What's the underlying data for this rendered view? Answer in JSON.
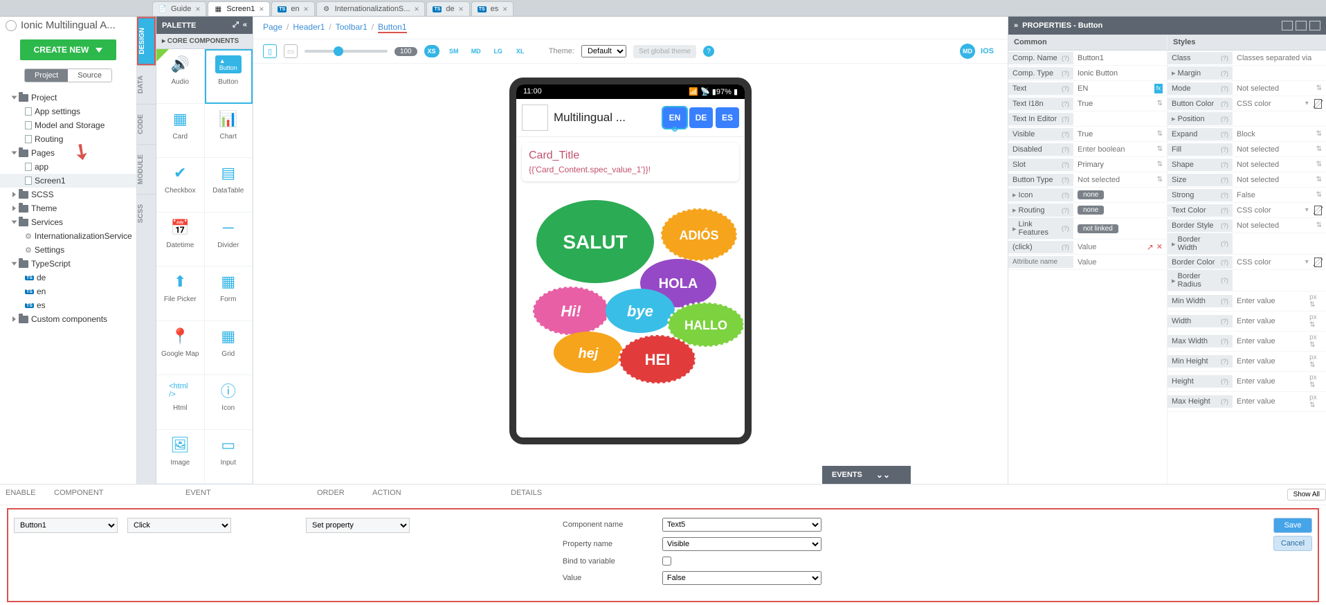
{
  "projectTitle": "Ionic Multilingual A...",
  "tabs": [
    {
      "label": "Guide",
      "icon": "doc"
    },
    {
      "label": "Screen1",
      "icon": "page",
      "active": true
    },
    {
      "label": "en",
      "icon": "ts"
    },
    {
      "label": "InternationalizationS...",
      "icon": "gear"
    },
    {
      "label": "de",
      "icon": "ts"
    },
    {
      "label": "es",
      "icon": "ts"
    }
  ],
  "createNew": "CREATE NEW",
  "toggle": {
    "on": "Project",
    "off": "Source"
  },
  "tree": [
    {
      "label": "Project",
      "lvl": 1,
      "open": true,
      "icon": "folder"
    },
    {
      "label": "App settings",
      "lvl": 2,
      "icon": "page"
    },
    {
      "label": "Model and Storage",
      "lvl": 2,
      "icon": "page"
    },
    {
      "label": "Routing",
      "lvl": 2,
      "icon": "page"
    },
    {
      "label": "Pages",
      "lvl": 1,
      "open": true,
      "icon": "folder"
    },
    {
      "label": "app",
      "lvl": 2,
      "icon": "page"
    },
    {
      "label": "Screen1",
      "lvl": 2,
      "icon": "page",
      "sel": true,
      "arrow": true
    },
    {
      "label": "SCSS",
      "lvl": 1,
      "icon": "folder"
    },
    {
      "label": "Theme",
      "lvl": 1,
      "icon": "folder"
    },
    {
      "label": "Services",
      "lvl": 1,
      "open": true,
      "icon": "folder"
    },
    {
      "label": "InternationalizationService",
      "lvl": 2,
      "icon": "gear"
    },
    {
      "label": "Settings",
      "lvl": 2,
      "icon": "gear"
    },
    {
      "label": "TypeScript",
      "lvl": 1,
      "open": true,
      "icon": "folder"
    },
    {
      "label": "de",
      "lvl": 2,
      "icon": "ts"
    },
    {
      "label": "en",
      "lvl": 2,
      "icon": "ts"
    },
    {
      "label": "es",
      "lvl": 2,
      "icon": "ts"
    },
    {
      "label": "Custom components",
      "lvl": 1,
      "icon": "folder"
    }
  ],
  "sideTabs": [
    "DESIGN",
    "DATA",
    "CODE",
    "MODULE",
    "SCSS"
  ],
  "palette": {
    "title": "PALETTE",
    "sub": "▸ CORE COMPONENTS",
    "items": [
      "Audio",
      "Button",
      "Card",
      "Chart",
      "Checkbox",
      "DataTable",
      "Datetime",
      "Divider",
      "File Picker",
      "Form",
      "Google Map",
      "Grid",
      "Html",
      "Icon",
      "Image",
      "Input"
    ]
  },
  "breadcrumb": [
    "Page",
    "Header1",
    "Toolbar1",
    "Button1"
  ],
  "toolbar": {
    "zoom": "100",
    "breakpoints": [
      "XS",
      "SM",
      "MD",
      "LG",
      "XL"
    ],
    "themeLabel": "Theme:",
    "themeValue": "Default",
    "globalTheme": "Set global theme",
    "md": "MD",
    "ios": "IOS"
  },
  "phone": {
    "time": "11:00",
    "battery": "97%",
    "title": "Multilingual ...",
    "langs": [
      "EN",
      "DE",
      "ES"
    ],
    "cardTitle": "Card_Title",
    "cardSub": "{{'Card_Content.spec_value_1'}}!"
  },
  "eventsLabel": "EVENTS",
  "props": {
    "title": "PROPERTIES - Button",
    "commonHdr": "Common",
    "stylesHdr": "Styles",
    "common": [
      {
        "k": "Comp. Name",
        "v": "Button1"
      },
      {
        "k": "Comp. Type",
        "v": "Ionic Button"
      },
      {
        "k": "Text",
        "v": "EN",
        "fx": true
      },
      {
        "k": "Text I18n",
        "v": "True",
        "dd": true
      },
      {
        "k": "Text In Editor",
        "v": ""
      },
      {
        "k": "Visible",
        "v": "True",
        "dd": true
      },
      {
        "k": "Disabled",
        "v": "",
        "ph": "Enter boolean",
        "dd": true
      },
      {
        "k": "Slot",
        "v": "Primary",
        "dd": true
      },
      {
        "k": "Button Type",
        "v": "",
        "ph": "Not selected",
        "dd": true
      },
      {
        "k": "Icon",
        "v": "none",
        "chip": true,
        "sub": true
      },
      {
        "k": "Routing",
        "v": "none",
        "chip": true,
        "sub": true
      },
      {
        "k": "Link Features",
        "v": "not linked",
        "chip": true,
        "sub": true
      },
      {
        "k": "(click)",
        "v": "",
        "ph": "Value",
        "red": true
      },
      {
        "k": "",
        "ph2": "Attribute name",
        "v": "",
        "ph": "Value"
      }
    ],
    "styles": [
      {
        "k": "Class",
        "v": "",
        "ph": "Classes separated via"
      },
      {
        "k": "Margin",
        "sub": true
      },
      {
        "k": "Mode",
        "v": "",
        "ph": "Not selected",
        "dd": true
      },
      {
        "k": "Button Color",
        "v": "",
        "ph": "CSS color",
        "np": true
      },
      {
        "k": "Position",
        "sub": true
      },
      {
        "k": "Expand",
        "v": "",
        "ph": "Block",
        "dd": true
      },
      {
        "k": "Fill",
        "v": "",
        "ph": "Not selected",
        "dd": true
      },
      {
        "k": "Shape",
        "v": "",
        "ph": "Not selected",
        "dd": true
      },
      {
        "k": "Size",
        "v": "",
        "ph": "Not selected",
        "dd": true
      },
      {
        "k": "Strong",
        "v": "",
        "ph": "False",
        "dd": true
      },
      {
        "k": "Text Color",
        "v": "",
        "ph": "CSS color",
        "np": true
      },
      {
        "k": "Border Style",
        "v": "",
        "ph": "Not selected",
        "dd": true
      },
      {
        "k": "Border Width",
        "sub": true
      },
      {
        "k": "Border Color",
        "v": "",
        "ph": "CSS color",
        "np": true
      },
      {
        "k": "Border Radius",
        "sub": true
      },
      {
        "k": "Min Width",
        "v": "",
        "ph": "Enter value",
        "unit": "px"
      },
      {
        "k": "Width",
        "v": "",
        "ph": "Enter value",
        "unit": "px"
      },
      {
        "k": "Max Width",
        "v": "",
        "ph": "Enter value",
        "unit": "px"
      },
      {
        "k": "Min Height",
        "v": "",
        "ph": "Enter value",
        "unit": "px"
      },
      {
        "k": "Height",
        "v": "",
        "ph": "Enter value",
        "unit": "px"
      },
      {
        "k": "Max Height",
        "v": "",
        "ph": "Enter value",
        "unit": "px"
      }
    ]
  },
  "eventsTable": {
    "headers": [
      "ENABLE",
      "COMPONENT",
      "EVENT",
      "ORDER",
      "ACTION",
      "DETAILS"
    ],
    "showAll": "Show All",
    "component": "Button1",
    "event": "Click",
    "action": "Set property",
    "details": [
      {
        "label": "Component name",
        "value": "Text5"
      },
      {
        "label": "Property name",
        "value": "Visible"
      },
      {
        "label": "Bind to variable",
        "checkbox": true
      },
      {
        "label": "Value",
        "value": "False"
      }
    ],
    "save": "Save",
    "cancel": "Cancel"
  }
}
